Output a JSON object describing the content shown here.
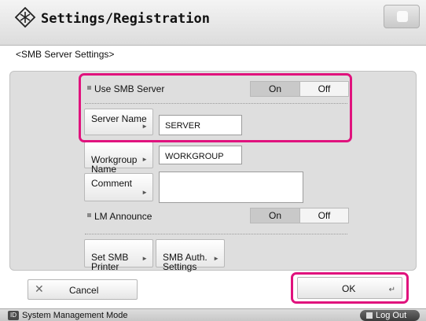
{
  "header": {
    "title": "Settings/Registration",
    "icon": "settings-registration-icon",
    "home_icon": "home-icon"
  },
  "breadcrumb": "<SMB Server Settings>",
  "form": {
    "use_smb_server": {
      "label": "Use SMB Server",
      "on_label": "On",
      "off_label": "Off",
      "selected": "On"
    },
    "server_name": {
      "button_label": "Server Name",
      "value": "SERVER"
    },
    "workgroup_name": {
      "button_label": "Workgroup\nName",
      "value": "WORKGROUP"
    },
    "comment": {
      "button_label": "Comment",
      "value": ""
    },
    "lm_announce": {
      "label": "LM Announce",
      "on_label": "On",
      "off_label": "Off",
      "selected": "On"
    },
    "set_smb_printer": {
      "label": "Set SMB\nPrinter"
    },
    "smb_auth_settings": {
      "label": "SMB Auth.\nSettings"
    }
  },
  "footer": {
    "cancel_label": "Cancel",
    "ok_label": "OK"
  },
  "status_bar": {
    "mode_text": "System Management Mode",
    "logout_label": "Log Out"
  },
  "colors": {
    "highlight": "#e0127d",
    "panel_bg": "#dedede"
  }
}
